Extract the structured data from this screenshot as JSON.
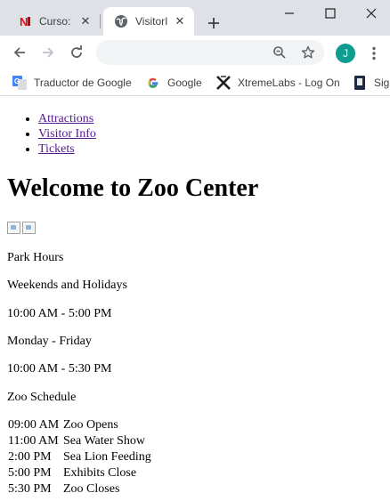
{
  "browser": {
    "tabs": [
      {
        "title": "Curso:",
        "icon": "netflix-n-icon",
        "active": false
      },
      {
        "title": "VisitorI",
        "icon": "globe-icon",
        "active": true
      }
    ],
    "avatar_letter": "J",
    "bookmarks": [
      {
        "label": "Traductor de Google",
        "icon": "google-translate-icon"
      },
      {
        "label": "Google",
        "icon": "google-g-icon"
      },
      {
        "label": "XtremeLabs - Log On",
        "icon": "xtremelabs-icon"
      },
      {
        "label": "Sign",
        "icon": "bookmark-icon"
      }
    ],
    "colors": {
      "accent": "#0f9d8f",
      "chrome": "#dee1e6"
    }
  },
  "page": {
    "nav": [
      "Attractions",
      "Visitor Info",
      "Tickets"
    ],
    "heading": "Welcome to Zoo Center",
    "park_hours_title": "Park Hours",
    "weekends_label": "Weekends and Holidays",
    "weekends_hours": "10:00 AM - 5:00 PM",
    "weekdays_label": "Monday - Friday",
    "weekdays_hours": "10:00 AM - 5:30 PM",
    "schedule_title": "Zoo Schedule",
    "schedule": [
      {
        "time": "09:00 AM",
        "event": "Zoo Opens"
      },
      {
        "time": "11:00 AM",
        "event": "Sea Water Show"
      },
      {
        "time": "2:00 PM",
        "event": "Sea Lion Feeding"
      },
      {
        "time": "5:00 PM",
        "event": "Exhibits Close"
      },
      {
        "time": "5:30 PM",
        "event": "Zoo Closes"
      }
    ]
  }
}
